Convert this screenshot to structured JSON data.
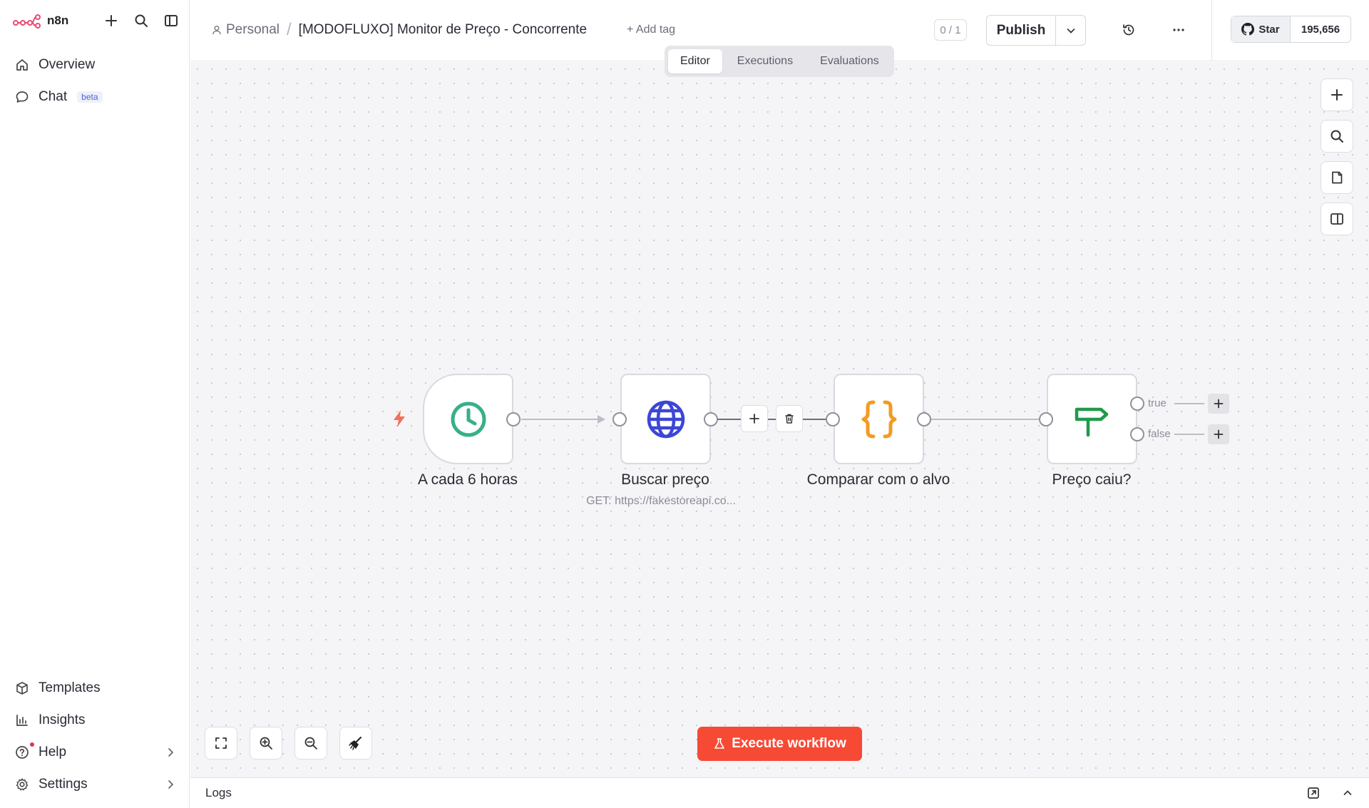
{
  "app": {
    "name": "n8n",
    "brand_color": "#ea4b71",
    "accent": "#f64a35"
  },
  "sidebar": {
    "top_items": [
      {
        "label": "Overview",
        "icon": "home-icon"
      },
      {
        "label": "Chat",
        "icon": "chat-icon",
        "badge": "beta"
      }
    ],
    "bottom_items": [
      {
        "label": "Templates",
        "icon": "box-icon"
      },
      {
        "label": "Insights",
        "icon": "bar-chart-icon"
      },
      {
        "label": "Help",
        "icon": "help-icon"
      },
      {
        "label": "Settings",
        "icon": "gear-icon"
      }
    ]
  },
  "header": {
    "project": "Personal",
    "workflow_name": "[MODOFLUXO] Monitor de Preço - Concorrente",
    "add_tag": "+ Add tag",
    "counter": "0 / 1",
    "publish_label": "Publish",
    "github": {
      "star_label": "Star",
      "count": "195,656"
    }
  },
  "tabs": [
    "Editor",
    "Executions",
    "Evaluations"
  ],
  "active_tab": "Editor",
  "nodes": [
    {
      "label": "A cada 6 horas",
      "subtitle": "",
      "icon": "clock-icon",
      "color": "#35b08a"
    },
    {
      "label": "Buscar preço",
      "subtitle": "GET: https://fakestoreapi.co...",
      "icon": "globe-icon",
      "color": "#3c46d6"
    },
    {
      "label": "Comparar com o alvo",
      "subtitle": "",
      "icon": "code-braces-icon",
      "color": "#f29b22"
    },
    {
      "label": "Preço caiu?",
      "subtitle": "",
      "icon": "signpost-icon",
      "color": "#1f9a4b"
    }
  ],
  "branches": {
    "true": "true",
    "false": "false"
  },
  "execute_label": "Execute workflow",
  "logs_label": "Logs"
}
